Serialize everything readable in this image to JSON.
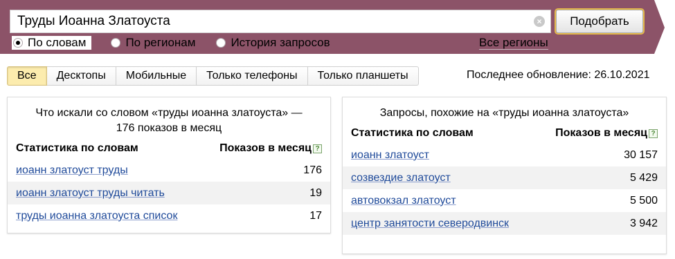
{
  "search": {
    "query": "Труды Иоанна Златоуста",
    "submit_label": "Подобрать",
    "clear_label": "×"
  },
  "modes": [
    {
      "label": "По словам",
      "checked": true
    },
    {
      "label": "По регионам",
      "checked": false
    },
    {
      "label": "История запросов",
      "checked": false
    }
  ],
  "regions_label": "Все регионы",
  "tabs": [
    "Все",
    "Десктопы",
    "Мобильные",
    "Только телефоны",
    "Только планшеты"
  ],
  "last_update": "Последнее обновление: 26.10.2021",
  "left_panel": {
    "title": "Что искали со словом «труды иоанна златоуста» — 176 показов в месяц",
    "col_phrase": "Статистика по словам",
    "col_count": "Показов в месяц",
    "rows": [
      {
        "phrase": "иоанн златоуст труды",
        "count": "176"
      },
      {
        "phrase": "иоанн златоуст труды читать",
        "count": "19"
      },
      {
        "phrase": "труды иоанна златоуста список",
        "count": "17"
      }
    ]
  },
  "right_panel": {
    "title": "Запросы, похожие на «труды иоанна златоуста»",
    "col_phrase": "Статистика по словам",
    "col_count": "Показов в месяц",
    "rows": [
      {
        "phrase": "иоанн златоуст",
        "count": "30 157"
      },
      {
        "phrase": "созвездие златоуст",
        "count": "5 429"
      },
      {
        "phrase": "автовокзал златоуст",
        "count": "5 500"
      },
      {
        "phrase": "центр занятости северодвинск",
        "count": "3 942"
      }
    ]
  },
  "colors": {
    "banner": "#8c5368",
    "link": "#1f4a9a",
    "active_tab": "#fcecae"
  }
}
